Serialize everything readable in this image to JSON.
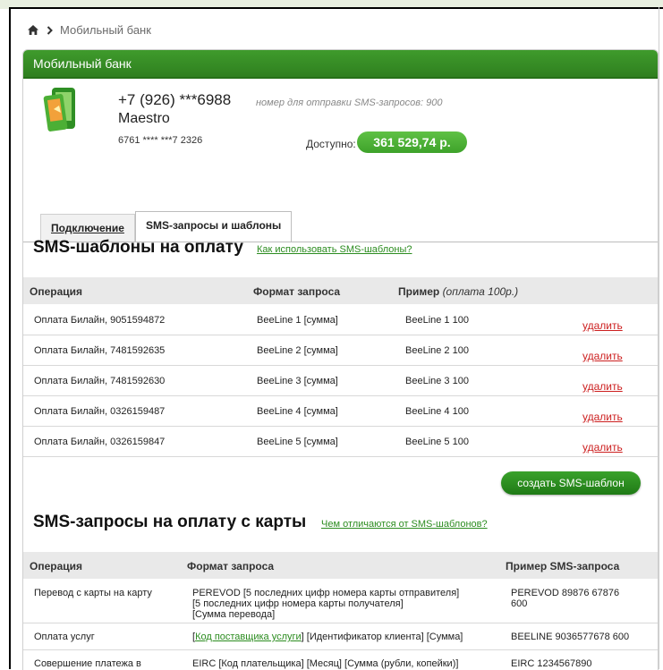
{
  "breadcrumb": {
    "current": "Мобильный банк"
  },
  "panel": {
    "title": "Мобильный банк"
  },
  "account": {
    "phone": "+7 (926) ***6988",
    "sms_hint": "номер для отправки SMS-запросов: 900",
    "card_name": "Maestro",
    "card_number": "6761 **** ***7 2326",
    "available_label": "Доступно:",
    "available_amount": "361 529,74 р."
  },
  "tabs": [
    {
      "label": "Подключение",
      "active": false
    },
    {
      "label": "SMS-запросы и шаблоны",
      "active": true
    }
  ],
  "templates": {
    "title": "SMS-шаблоны на оплату",
    "help_link": "Как использовать SMS-шаблоны?",
    "headers": {
      "operation": "Операция",
      "format": "Формат запроса",
      "example": "Пример",
      "example_note": "(оплата 100р.)"
    },
    "rows": [
      {
        "operation": "Оплата Билайн, 9051594872",
        "format": "BeeLine 1 [сумма]",
        "example": "BeeLine 1 100",
        "action": "удалить"
      },
      {
        "operation": "Оплата Билайн, 7481592635",
        "format": "BeeLine 2 [сумма]",
        "example": "BeeLine 2 100",
        "action": "удалить"
      },
      {
        "operation": "Оплата Билайн, 7481592630",
        "format": "BeeLine 3 [сумма]",
        "example": "BeeLine 3 100",
        "action": "удалить"
      },
      {
        "operation": "Оплата Билайн, 0326159487",
        "format": "BeeLine 4 [сумма]",
        "example": "BeeLine 4 100",
        "action": "удалить"
      },
      {
        "operation": "Оплата Билайн, 0326159847",
        "format": "BeeLine 5 [сумма]",
        "example": "BeeLine 5 100",
        "action": "удалить"
      }
    ],
    "create_button": "создать SMS-шаблон"
  },
  "requests": {
    "title": "SMS-запросы на оплату с карты",
    "help_link": "Чем отличаются от SMS-шаблонов?",
    "headers": {
      "operation": "Операция",
      "format": "Формат запроса",
      "example": "Пример SMS-запроса"
    },
    "rows": [
      {
        "operation": "Перевод с карты на карту",
        "format_lines": [
          "PEREVOD [5 последних цифр номера карты отправителя]",
          "[5 последних цифр номера карты получателя]",
          "[Сумма перевода]"
        ],
        "example_lines": [
          "PEREVOD 89876 67876",
          "600"
        ]
      },
      {
        "operation": "Оплата услуг",
        "format_link": "Код поставщика услуги",
        "format_prefix": "[",
        "format_rest": "] [Идентификатор клиента] [Сумма]",
        "example": "BEELINE 9036577678 600"
      },
      {
        "operation": "Совершение платежа в",
        "format": "EIRC [Код плательщика] [Месяц] [Сумма (рубли, копейки)]",
        "example": "EIRC 1234567890"
      }
    ]
  },
  "colors": {
    "brand_green": "#3f9b2c",
    "link_green": "#2b8c1f",
    "delete_red": "#cc1f1f"
  }
}
